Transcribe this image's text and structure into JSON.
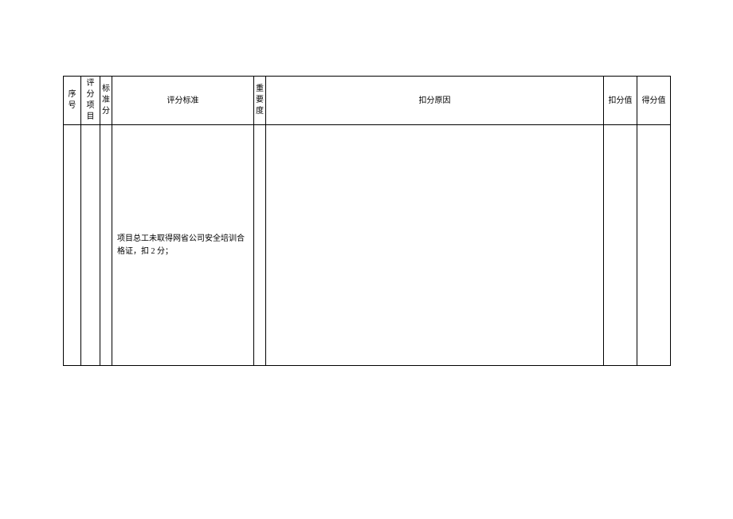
{
  "table": {
    "headers": {
      "seq": "序号",
      "item": "评分项目",
      "std_score": "标准分",
      "criteria": "评分标准",
      "importance": "重要度",
      "reason": "扣分原因",
      "deduct": "扣分值",
      "score": "得分值"
    },
    "rows": [
      {
        "seq": "",
        "item": "",
        "std_score": "",
        "criteria": "项目总工未取得网省公司安全培训合格证，扣 2 分；",
        "importance": "",
        "reason": "",
        "deduct": "",
        "score": ""
      }
    ]
  }
}
